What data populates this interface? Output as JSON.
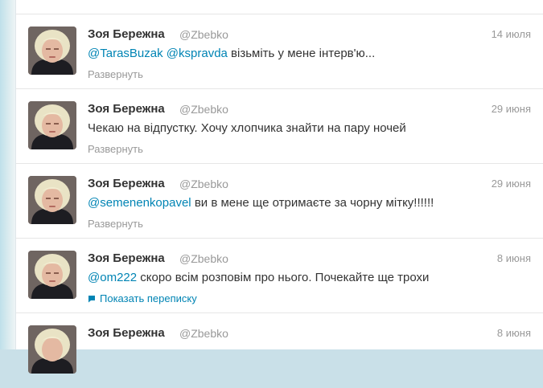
{
  "tweets": [
    {
      "name": "Зоя Бережна",
      "handle": "@Zbebko",
      "date": "14 июля",
      "mention1": "@TarasBuzak",
      "mention2": "@kspravda",
      "body": "візьміть у мене інтерв'ю...",
      "action": "Развернуть"
    },
    {
      "name": "Зоя Бережна",
      "handle": "@Zbebko",
      "date": "29 июня",
      "body": "Чекаю на відпустку. Хочу хлопчика знайти на пару ночей",
      "action": "Развернуть"
    },
    {
      "name": "Зоя Бережна",
      "handle": "@Zbebko",
      "date": "29 июня",
      "mention1": "@semenenkopavel",
      "body": "ви в мене ще отримаєте за чорну мітку!!!!!!",
      "action": "Развернуть"
    },
    {
      "name": "Зоя Бережна",
      "handle": "@Zbebko",
      "date": "8 июня",
      "mention1": "@om222",
      "body": "скоро всім розповім про нього. Почекайте ще трохи",
      "action": "Показать переписку"
    },
    {
      "name": "Зоя Бережна",
      "handle": "@Zbebko",
      "date": "8 июня"
    }
  ],
  "colors": {
    "link": "#0084b4",
    "muted": "#999999",
    "text": "#333333"
  }
}
